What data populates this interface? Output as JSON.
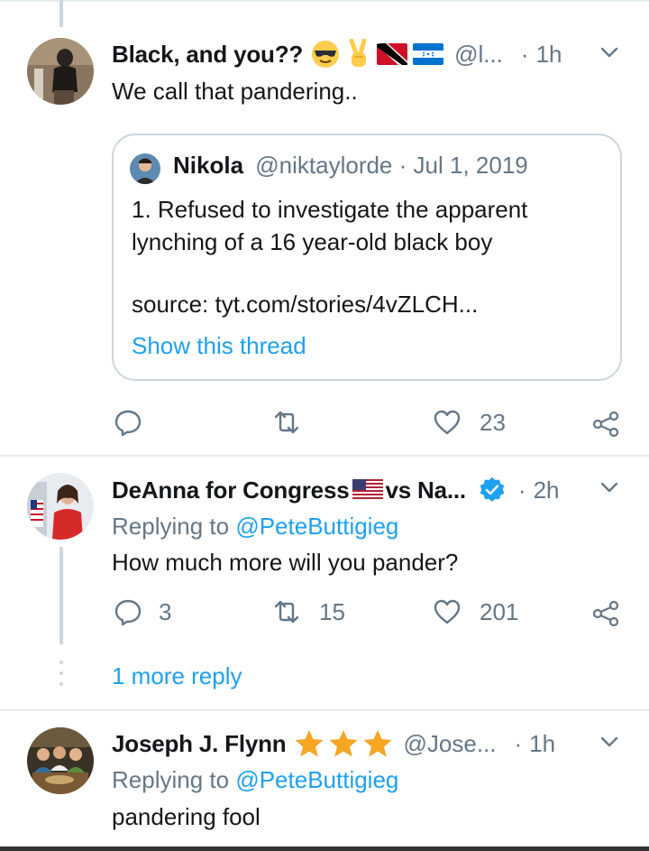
{
  "tweets": [
    {
      "name": "Black, and you??",
      "handle": "@l...",
      "time": "1h",
      "text": "We call that pandering..",
      "quote": {
        "name": "Nikola",
        "handle": "@niktaylorde",
        "date": "Jul 1, 2019",
        "text": "1. Refused to investigate the apparent lynching of a 16 year-old black boy",
        "source": "source: tyt.com/stories/4vZLCH...",
        "thread_link": "Show this thread"
      },
      "actions": {
        "reply": "",
        "retweet": "",
        "like": "23"
      }
    },
    {
      "name": "DeAnna for Congress",
      "name_suffix": "vs Na...",
      "time": "2h",
      "reply_prefix": "Replying to",
      "reply_mention": "@PeteButtigieg",
      "text": "How much more will you pander?",
      "actions": {
        "reply": "3",
        "retweet": "15",
        "like": "201"
      },
      "more_replies": "1 more reply"
    },
    {
      "name": "Joseph J. Flynn",
      "handle": "@Jose...",
      "time": "1h",
      "reply_prefix": "Replying to",
      "reply_mention": "@PeteButtigieg",
      "text": "pandering fool"
    }
  ],
  "colors": {
    "link": "#1da1f2",
    "muted": "#657786",
    "border": "#e6ecf0",
    "verified": "#1da1f2",
    "star": "#f5a623"
  },
  "icons": [
    "reply-icon",
    "retweet-icon",
    "like-icon",
    "share-icon",
    "caret-down-icon",
    "verified-badge-icon",
    "star-icon",
    "sunglasses-emoji-icon",
    "victory-hand-emoji-icon",
    "trinidad-flag-icon",
    "honduras-flag-icon",
    "us-flag-icon"
  ]
}
